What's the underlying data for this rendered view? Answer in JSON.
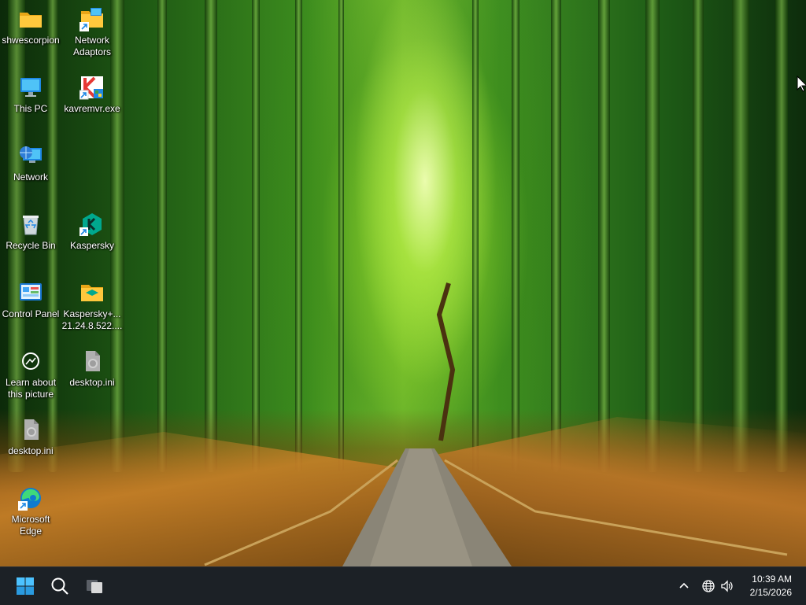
{
  "desktop": {
    "icons": [
      {
        "id": "shwescorpion",
        "label": "shwescorpion",
        "icon": "folder-icon"
      },
      {
        "id": "network-adaptors",
        "label": "Network Adaptors",
        "icon": "network-adaptors-icon"
      },
      {
        "id": "this-pc",
        "label": "This PC",
        "icon": "monitor-icon"
      },
      {
        "id": "kavremvr",
        "label": "kavremvr.exe",
        "icon": "kaspersky-k-icon"
      },
      {
        "id": "network",
        "label": "Network",
        "icon": "network-globe-icon"
      },
      {
        "id": "recycle-bin",
        "label": "Recycle Bin",
        "icon": "recycle-bin-icon"
      },
      {
        "id": "kaspersky",
        "label": "Kaspersky",
        "icon": "kaspersky-hex-icon"
      },
      {
        "id": "control-panel",
        "label": "Control Panel",
        "icon": "control-panel-icon"
      },
      {
        "id": "kaspersky-folder",
        "label": "Kaspersky+... 21.24.8.522....",
        "icon": "folder-zip-icon"
      },
      {
        "id": "learn-picture",
        "label": "Learn about this picture",
        "icon": "camera-circle-icon"
      },
      {
        "id": "desktop-ini-1",
        "label": "desktop.ini",
        "icon": "settings-file-icon"
      },
      {
        "id": "desktop-ini-2",
        "label": "desktop.ini",
        "icon": "settings-file-icon"
      },
      {
        "id": "edge",
        "label": "Microsoft Edge",
        "icon": "edge-icon"
      }
    ]
  },
  "taskbar": {
    "buttons": [
      {
        "id": "start",
        "icon": "windows-start-icon"
      },
      {
        "id": "search",
        "icon": "search-icon"
      },
      {
        "id": "task-view",
        "icon": "task-view-icon"
      }
    ],
    "tray": {
      "chevron_icon": "chevron-up-icon",
      "network_icon": "globe-network-icon",
      "volume_icon": "speaker-icon",
      "time": "10:39 AM",
      "date": "2/15/2026"
    }
  },
  "colors": {
    "taskbar_bg": "#1c2126",
    "start_blue": "#4cc2ff"
  }
}
